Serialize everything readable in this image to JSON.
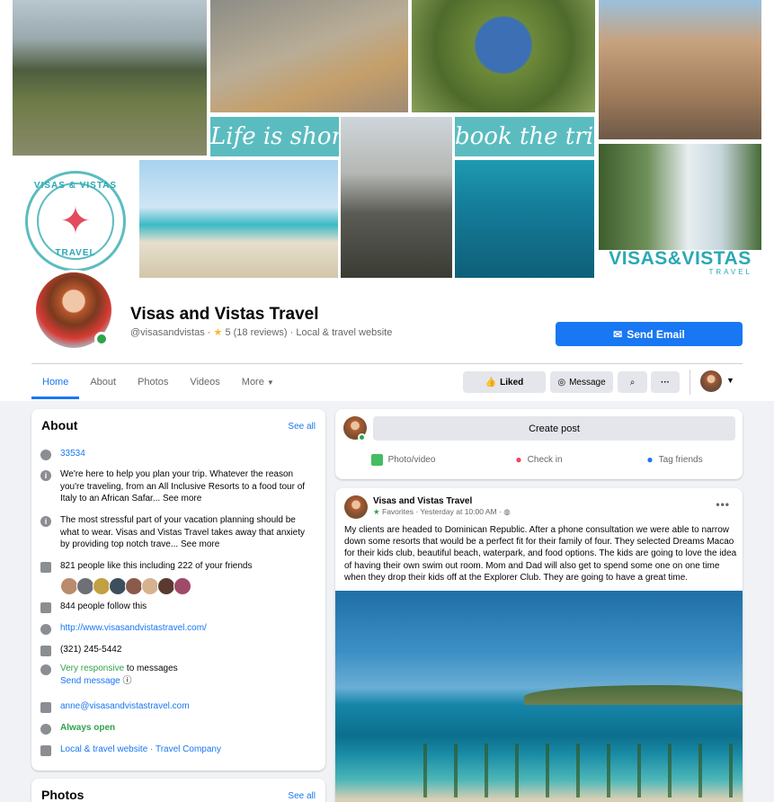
{
  "cover": {
    "life_text": "Life is short,",
    "book_text": "book the trip.",
    "brand_main": "VISAS&VISTAS",
    "brand_sub": "TRAVEL",
    "logo_top": "VISAS & VISTAS",
    "logo_bottom": "TRAVEL"
  },
  "page": {
    "name": "Visas and Vistas Travel",
    "handle": "@visasandvistas",
    "rating": "5",
    "reviews": "(18 reviews)",
    "category": "Local & travel website",
    "send_email": "Send Email"
  },
  "tabs": [
    "Home",
    "About",
    "Photos",
    "Videos",
    "More"
  ],
  "actions": {
    "liked": "Liked",
    "message": "Message"
  },
  "about": {
    "title": "About",
    "see_all": "See all",
    "zip": "33534",
    "desc1": "We're here to help you plan your trip. Whatever the reason you're traveling, from an All Inclusive Resorts to a food tour of Italy to an African Safar...",
    "desc1_more": "See more",
    "desc2": "The most stressful part of your vacation planning should be what to wear. Visas and Vistas Travel takes away that anxiety by providing top notch trave...",
    "desc2_more": "See more",
    "likes": "821 people like this including 222 of your friends",
    "follows": "844 people follow this",
    "website": "http://www.visasandvistastravel.com/",
    "phone": "(321) 245-5442",
    "responsive": "Very responsive",
    "responsive_rest": " to messages",
    "send_message": "Send message",
    "email": "anne@visasandvistastravel.com",
    "hours": "Always open",
    "categories": "Local & travel website · Travel Company"
  },
  "photos": {
    "title": "Photos",
    "see_all": "See all"
  },
  "create_post": {
    "placeholder": "Create post",
    "photo_video": "Photo/video",
    "check_in": "Check in",
    "tag_friends": "Tag friends"
  },
  "post": {
    "author": "Visas and Vistas Travel",
    "favorites": "Favorites",
    "time": "Yesterday at 10:00 AM",
    "body": "My clients are headed to Dominican Republic. After a phone consultation we were able to narrow down some resorts that would be a perfect fit for their family of four. They selected Dreams Macao for their kids club, beautiful beach, waterpark, and food options. The kids are going to love the idea of having their own swim out room. Mom and Dad will also get to spend some one on one time when they drop their kids off at the Explorer Club. They are going to have a great time."
  },
  "colors": {
    "accent": "#1877f2",
    "online": "#31a24c",
    "brand_teal": "#2aa8b5",
    "logo_star": "#e34b5e"
  },
  "icons": {
    "email": "envelope-icon",
    "liked": "thumbs-up-icon",
    "message": "messenger-icon",
    "search": "search-icon",
    "more": "more-icon"
  }
}
